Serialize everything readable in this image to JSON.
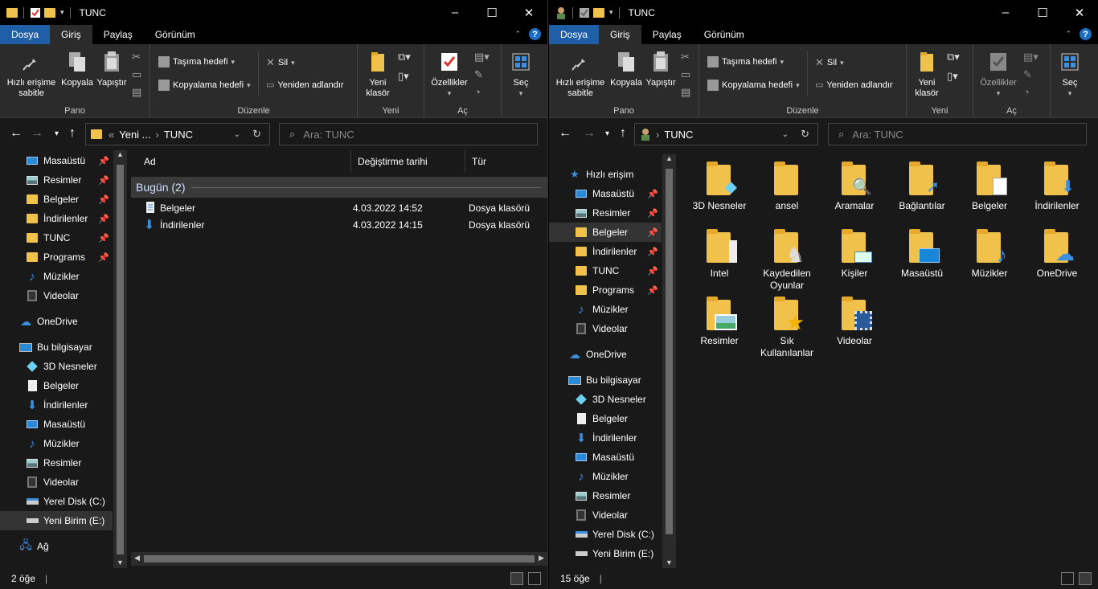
{
  "left": {
    "title": "TUNC",
    "menu": [
      "Dosya",
      "Giriş",
      "Paylaş",
      "Görünüm"
    ],
    "ribbon": {
      "pano": {
        "label": "Pano",
        "pin": "Hızlı erişime sabitle",
        "copy": "Kopyala",
        "paste": "Yapıştır"
      },
      "duzenle": {
        "label": "Düzenle",
        "move": "Taşıma hedefi",
        "copyto": "Kopyalama hedefi",
        "delete": "Sil",
        "rename": "Yeniden adlandır"
      },
      "yeni": {
        "label": "Yeni",
        "newfolder": "Yeni klasör"
      },
      "ac": {
        "label": "Aç",
        "props": "Özellikler"
      },
      "sec": {
        "label": "Seç"
      }
    },
    "address": {
      "crumb_prefix": "«",
      "crumb1": "Yeni ...",
      "crumb2": "TUNC"
    },
    "search_placeholder": "Ara: TUNC",
    "nav": [
      {
        "label": "Masaüstü",
        "icon": "desktop-icon",
        "pinned": true
      },
      {
        "label": "Resimler",
        "icon": "pictures-icon",
        "pinned": true
      },
      {
        "label": "Belgeler",
        "icon": "folder-icon",
        "pinned": true
      },
      {
        "label": "İndirilenler",
        "icon": "folder-icon",
        "pinned": true
      },
      {
        "label": "TUNC",
        "icon": "folder-icon",
        "pinned": true
      },
      {
        "label": "Programs",
        "icon": "folder-icon",
        "pinned": true
      },
      {
        "label": "Müzikler",
        "icon": "music-icon",
        "pinned": false
      },
      {
        "label": "Videolar",
        "icon": "video-icon",
        "pinned": false
      },
      {
        "label": "OneDrive",
        "icon": "cloud-icon",
        "pinned": false
      },
      {
        "label": "Bu bilgisayar",
        "icon": "computer-icon",
        "pinned": false
      },
      {
        "label": "3D Nesneler",
        "icon": "cube-icon",
        "pinned": false
      },
      {
        "label": "Belgeler",
        "icon": "document-icon",
        "pinned": false
      },
      {
        "label": "İndirilenler",
        "icon": "download-icon",
        "pinned": false
      },
      {
        "label": "Masaüstü",
        "icon": "desktop-icon",
        "pinned": false
      },
      {
        "label": "Müzikler",
        "icon": "music-icon",
        "pinned": false
      },
      {
        "label": "Resimler",
        "icon": "pictures-icon",
        "pinned": false
      },
      {
        "label": "Videolar",
        "icon": "video-icon",
        "pinned": false
      },
      {
        "label": "Yerel Disk (C:)",
        "icon": "drive-icon",
        "pinned": false
      },
      {
        "label": "Yeni Birim (E:)",
        "icon": "usb-drive-icon",
        "pinned": false
      },
      {
        "label": "Ağ",
        "icon": "network-icon",
        "pinned": false
      }
    ],
    "columns": {
      "name": "Ad",
      "modified": "Değiştirme tarihi",
      "type": "Tür"
    },
    "group": "Bugün (2)",
    "files": [
      {
        "name": "Belgeler",
        "modified": "4.03.2022 14:52",
        "type": "Dosya klasörü",
        "icon": "document-icon"
      },
      {
        "name": "İndirilenler",
        "modified": "4.03.2022 14:15",
        "type": "Dosya klasörü",
        "icon": "download-icon"
      }
    ],
    "status": "2 öğe"
  },
  "right": {
    "title": "TUNC",
    "menu": [
      "Dosya",
      "Giriş",
      "Paylaş",
      "Görünüm"
    ],
    "ribbon": {
      "pano": {
        "label": "Pano",
        "pin": "Hızlı erişime sabitle",
        "copy": "Kopyala",
        "paste": "Yapıştır"
      },
      "duzenle": {
        "label": "Düzenle",
        "move": "Taşıma hedefi",
        "copyto": "Kopyalama hedefi",
        "delete": "Sil",
        "rename": "Yeniden adlandır"
      },
      "yeni": {
        "label": "Yeni",
        "newfolder": "Yeni klasör"
      },
      "ac": {
        "label": "Aç",
        "props": "Özellikler"
      },
      "sec": {
        "label": "Seç"
      }
    },
    "address": {
      "crumb1": "TUNC"
    },
    "search_placeholder": "Ara: TUNC",
    "nav": [
      {
        "label": "Hızlı erişim",
        "icon": "star-icon",
        "pinned": false
      },
      {
        "label": "Masaüstü",
        "icon": "desktop-icon",
        "pinned": true
      },
      {
        "label": "Resimler",
        "icon": "pictures-icon",
        "pinned": true
      },
      {
        "label": "Belgeler",
        "icon": "folder-icon",
        "pinned": true
      },
      {
        "label": "İndirilenler",
        "icon": "folder-icon",
        "pinned": true
      },
      {
        "label": "TUNC",
        "icon": "folder-icon",
        "pinned": true
      },
      {
        "label": "Programs",
        "icon": "folder-icon",
        "pinned": true
      },
      {
        "label": "Müzikler",
        "icon": "music-icon",
        "pinned": false
      },
      {
        "label": "Videolar",
        "icon": "video-icon",
        "pinned": false
      },
      {
        "label": "OneDrive",
        "icon": "cloud-icon",
        "pinned": false
      },
      {
        "label": "Bu bilgisayar",
        "icon": "computer-icon",
        "pinned": false
      },
      {
        "label": "3D Nesneler",
        "icon": "cube-icon",
        "pinned": false
      },
      {
        "label": "Belgeler",
        "icon": "document-icon",
        "pinned": false
      },
      {
        "label": "İndirilenler",
        "icon": "download-icon",
        "pinned": false
      },
      {
        "label": "Masaüstü",
        "icon": "desktop-icon",
        "pinned": false
      },
      {
        "label": "Müzikler",
        "icon": "music-icon",
        "pinned": false
      },
      {
        "label": "Resimler",
        "icon": "pictures-icon",
        "pinned": false
      },
      {
        "label": "Videolar",
        "icon": "video-icon",
        "pinned": false
      },
      {
        "label": "Yerel Disk (C:)",
        "icon": "drive-icon",
        "pinned": false
      },
      {
        "label": "Yeni Birim (E:)",
        "icon": "usb-drive-icon",
        "pinned": false
      }
    ],
    "tiles": [
      {
        "name": "3D Nesneler",
        "overlay": "cube-icon"
      },
      {
        "name": "ansel",
        "overlay": ""
      },
      {
        "name": "Aramalar",
        "overlay": "magnifier-icon"
      },
      {
        "name": "Bağlantılar",
        "overlay": "shortcut-arrow-icon"
      },
      {
        "name": "Belgeler",
        "overlay": "document-icon"
      },
      {
        "name": "İndirilenler",
        "overlay": "download-icon"
      },
      {
        "name": "Intel",
        "overlay": "pages-icon"
      },
      {
        "name": "Kaydedilen Oyunlar",
        "overlay": "chess-icon"
      },
      {
        "name": "Kişiler",
        "overlay": "contact-card-icon"
      },
      {
        "name": "Masaüstü",
        "overlay": "desktop-icon"
      },
      {
        "name": "Müzikler",
        "overlay": "music-icon"
      },
      {
        "name": "OneDrive",
        "overlay": "cloud-icon"
      },
      {
        "name": "Resimler",
        "overlay": "pictures-icon"
      },
      {
        "name": "Sık Kullanılanlar",
        "overlay": "star-icon"
      },
      {
        "name": "Videolar",
        "overlay": "film-icon"
      }
    ],
    "status": "15 öğe"
  },
  "colors": {
    "accent": "#1f5fa8",
    "folder": "#f0c24b",
    "background": "#191919",
    "ribbon": "#2b2b2b"
  }
}
